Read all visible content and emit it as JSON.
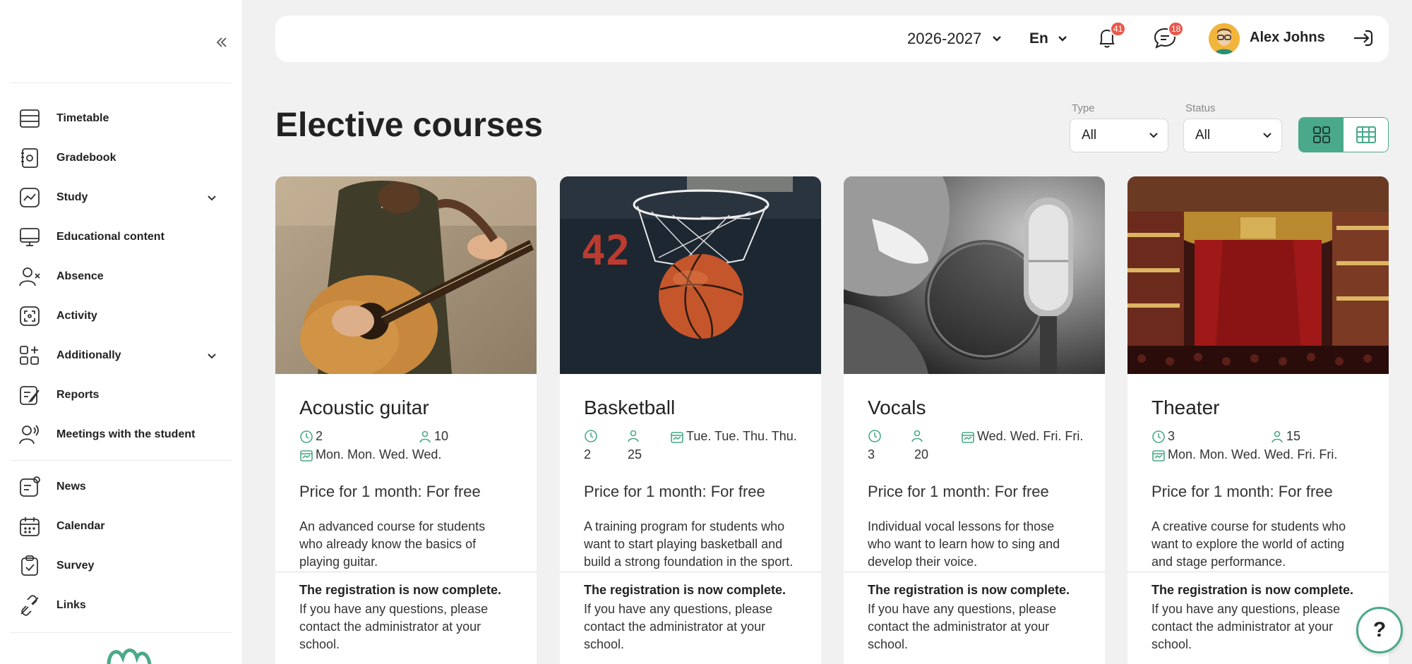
{
  "sidebar": {
    "collapse_icon": "double-chevron-left-icon",
    "items": [
      {
        "label": "Timetable",
        "icon": "timetable-icon"
      },
      {
        "label": "Gradebook",
        "icon": "gradebook-icon"
      },
      {
        "label": "Study",
        "icon": "study-chart-icon",
        "expandable": true
      },
      {
        "label": "Educational content",
        "icon": "monitor-icon"
      },
      {
        "label": "Absence",
        "icon": "user-x-icon"
      },
      {
        "label": "Activity",
        "icon": "activity-icon"
      },
      {
        "label": "Additionally",
        "icon": "grid-plus-icon",
        "expandable": true
      },
      {
        "label": "Reports",
        "icon": "reports-icon"
      },
      {
        "label": "Meetings with the student",
        "icon": "meetings-icon"
      },
      {
        "label": "News",
        "icon": "news-icon"
      },
      {
        "label": "Calendar",
        "icon": "calendar-icon"
      },
      {
        "label": "Survey",
        "icon": "survey-icon"
      },
      {
        "label": "Links",
        "icon": "link-icon"
      }
    ]
  },
  "header": {
    "year": "2026-2027",
    "language": "En",
    "notifications_count": "41",
    "messages_count": "18",
    "user_name": "Alex Johns"
  },
  "page": {
    "title": "Elective courses",
    "filters": {
      "type_label": "Type",
      "type_value": "All",
      "status_label": "Status",
      "status_value": "All"
    }
  },
  "courses": [
    {
      "title": "Acoustic guitar",
      "hours": "2",
      "students": "10",
      "days": "Mon. Mon. Wed. Wed.",
      "price": "Price for 1 month: For free",
      "description": "An advanced course for students who already know the basics of playing guitar.",
      "registration_title": "The registration is now complete.",
      "registration_note": "If you have any questions, please contact the administrator at your school."
    },
    {
      "title": "Basketball",
      "hours": "2",
      "students": "25",
      "days": "Tue. Tue. Thu. Thu.",
      "price": "Price for 1 month: For free",
      "description": "A training program for students who want to start playing basketball and build a strong foundation in the sport.",
      "registration_title": "The registration is now complete.",
      "registration_note": "If you have any questions, please contact the administrator at your school."
    },
    {
      "title": "Vocals",
      "hours": "3",
      "students": "20",
      "days": "Wed. Wed. Fri. Fri.",
      "price": "Price for 1 month: For free",
      "description": "Individual vocal lessons for those who want to learn how to sing and develop their voice.",
      "registration_title": "The registration is now complete.",
      "registration_note": "If you have any questions, please contact the administrator at your school."
    },
    {
      "title": "Theater",
      "hours": "3",
      "students": "15",
      "days": "Mon. Mon. Wed. Wed. Fri. Fri.",
      "price": "Price for 1 month: For free",
      "description": "A creative course for students who want to explore the world of acting and stage performance.",
      "registration_title": "The registration is now complete.",
      "registration_note": "If you have any questions, please contact the administrator at your school."
    }
  ],
  "help": {
    "label": "?"
  },
  "colors": {
    "accent": "#4aa98a",
    "badge": "#e8594c",
    "background": "#f1f1f1"
  }
}
